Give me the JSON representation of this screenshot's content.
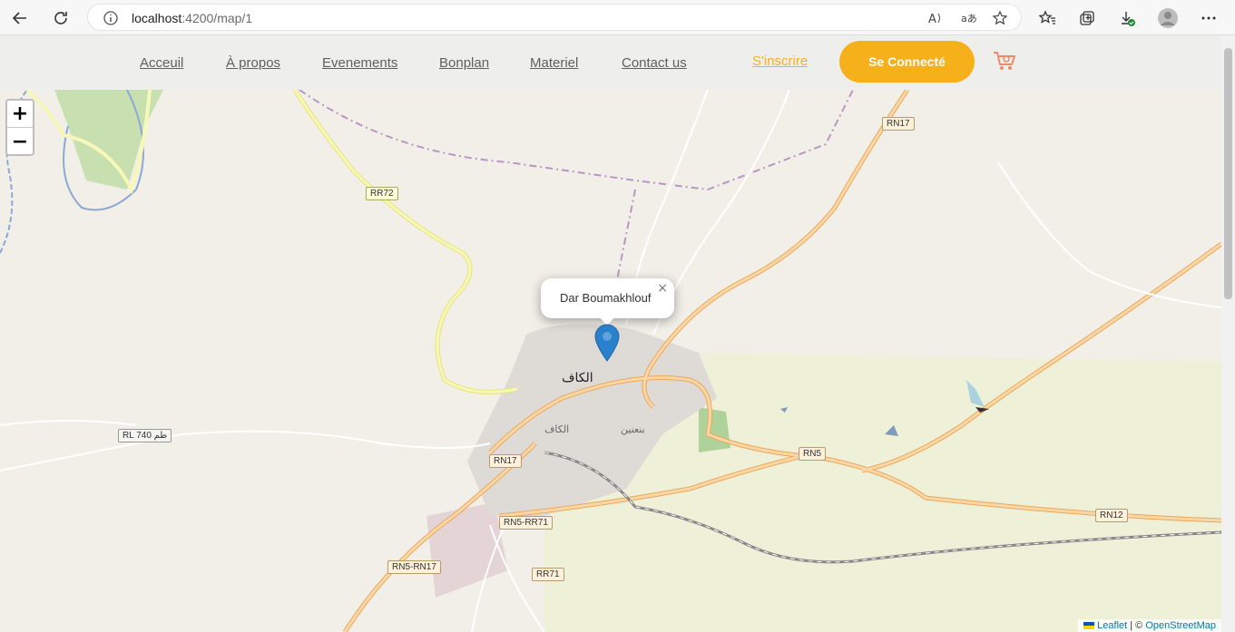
{
  "browser": {
    "url_host": "localhost",
    "url_path": ":4200/map/1"
  },
  "nav": {
    "links": [
      "Acceuil",
      "À propos",
      "Evenements",
      "Bonplan",
      "Materiel",
      "Contact us"
    ],
    "signup": "S'inscrire",
    "connect": "Se Connecté"
  },
  "map": {
    "zoom_in": "+",
    "zoom_out": "−",
    "popup_text": "Dar Boumakhlouf",
    "popup_close": "×",
    "city_label": "الكاف",
    "city_label_small": "الكاف",
    "district_label": "بنعنين",
    "road_labels": [
      "RN17",
      "RR72",
      "RL 740 طم",
      "RN17",
      "RN5",
      "RN5-RR71",
      "RN5-RN17",
      "RR71",
      "RN12"
    ],
    "attribution_leaflet": "Leaflet",
    "attribution_sep": " | © ",
    "attribution_osm": "OpenStreetMap"
  },
  "colors": {
    "accent": "#f6b11a",
    "marker": "#2a81cb"
  }
}
